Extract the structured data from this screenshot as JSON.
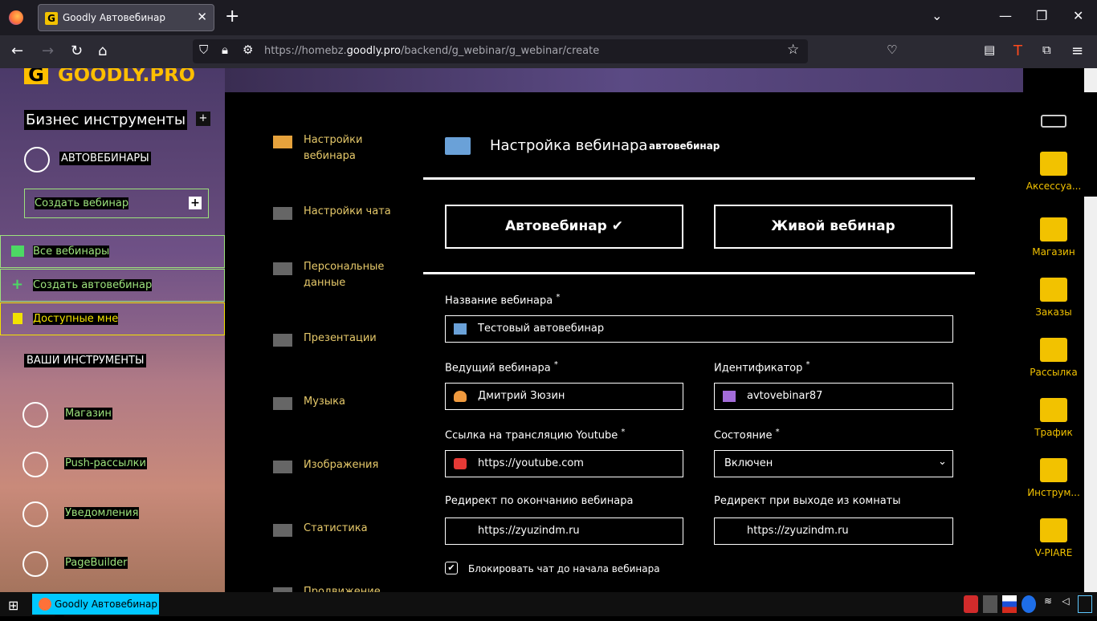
{
  "browser": {
    "tab_title": "Goodly Автовебинар",
    "tab_icon": "G",
    "url_prefix": "https://homebz.",
    "url_domain": "goodly.pro",
    "url_path": "/backend/g_webinar/g_webinar/create"
  },
  "sidebar": {
    "logo": "GOODLY.PRO",
    "logo_letter": "G",
    "section_title": "Бизнес инструменты",
    "section_plus": "+",
    "group_label": "АВТОВЕБИНАРЫ",
    "create_webinar": "Создать вебинар",
    "create_plus": "+",
    "items": [
      {
        "label": "Все вебинары"
      },
      {
        "label": "Создать автовебинар"
      },
      {
        "label": "Доступные мне"
      }
    ],
    "tools_title": "ВАШИ ИНСТРУМЕНТЫ",
    "tools": [
      {
        "label": "Магазин"
      },
      {
        "label": "Push-рассылки"
      },
      {
        "label": "Уведомления"
      },
      {
        "label": "PageBuilder"
      }
    ]
  },
  "settings_menu": [
    {
      "label": "Настройки вебинара"
    },
    {
      "label": "Настройки чата"
    },
    {
      "label": "Персональные данные"
    },
    {
      "label": "Презентации"
    },
    {
      "label": "Музыка"
    },
    {
      "label": "Изображения"
    },
    {
      "label": "Статистика"
    },
    {
      "label": "Продвижение"
    }
  ],
  "form": {
    "title": "Настройка вебинара",
    "subtitle": "автовебинар",
    "type_auto": "Автовебинар ✔",
    "type_live": "Живой вебинар",
    "name_label": "Название вебинара",
    "name_value": "Тестовый автовебинар",
    "host_label": "Ведущий вебинара",
    "host_value": "Дмитрий Зюзин",
    "id_label": "Идентификатор",
    "id_value": "avtovebinar87",
    "youtube_label": "Ссылка на трансляцию Youtube",
    "youtube_value": "https://youtube.com",
    "state_label": "Состояние",
    "state_value": "Включен",
    "redirect_end_label": "Редирект по окончанию вебинара",
    "redirect_end_value": "https://zyuzindm.ru",
    "redirect_exit_label": "Редирект при выходе из комнаты",
    "redirect_exit_value": "https://zyuzindm.ru",
    "block_chat_label": "Блокировать чат до начала вебинара",
    "block_chat_checked": "✔",
    "required_mark": "*"
  },
  "right_bar": [
    {
      "label": "Аксессуа..."
    },
    {
      "label": "Магазин"
    },
    {
      "label": "Заказы"
    },
    {
      "label": "Рассылка"
    },
    {
      "label": "Трафик"
    },
    {
      "label": "Инструм..."
    },
    {
      "label": "V-PIARE"
    }
  ],
  "taskbar": {
    "task_label": "Goodly Автовебинар — ..."
  }
}
